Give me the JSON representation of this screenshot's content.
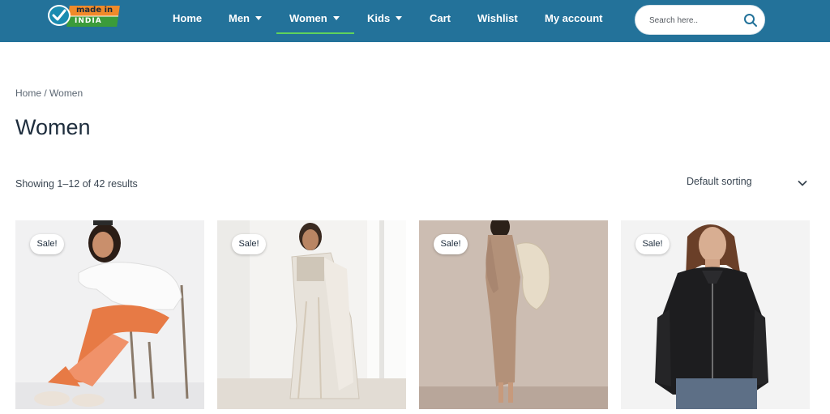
{
  "header": {
    "logo": {
      "line1": "made in",
      "line2": "INDIA"
    },
    "nav": [
      {
        "label": "Home",
        "has_dropdown": false
      },
      {
        "label": "Men",
        "has_dropdown": true
      },
      {
        "label": "Women",
        "has_dropdown": true,
        "active": true
      },
      {
        "label": "Kids",
        "has_dropdown": true
      },
      {
        "label": "Cart",
        "has_dropdown": false
      },
      {
        "label": "Wishlist",
        "has_dropdown": false
      },
      {
        "label": "My account",
        "has_dropdown": false
      }
    ],
    "search": {
      "placeholder": "Search here..",
      "icon": "search-icon"
    },
    "colors": {
      "bar": "#23729a",
      "active_underline": "#5fd35b"
    }
  },
  "breadcrumb": {
    "home": "Home",
    "separator": " / ",
    "current": "Women"
  },
  "page_title": "Women",
  "result_count": "Showing 1–12 of 42 results",
  "sorting": {
    "selected": "Default sorting",
    "icon": "chevron-down-icon"
  },
  "products": [
    {
      "badge": "Sale!"
    },
    {
      "badge": "Sale!"
    },
    {
      "badge": "Sale!"
    },
    {
      "badge": "Sale!"
    }
  ]
}
